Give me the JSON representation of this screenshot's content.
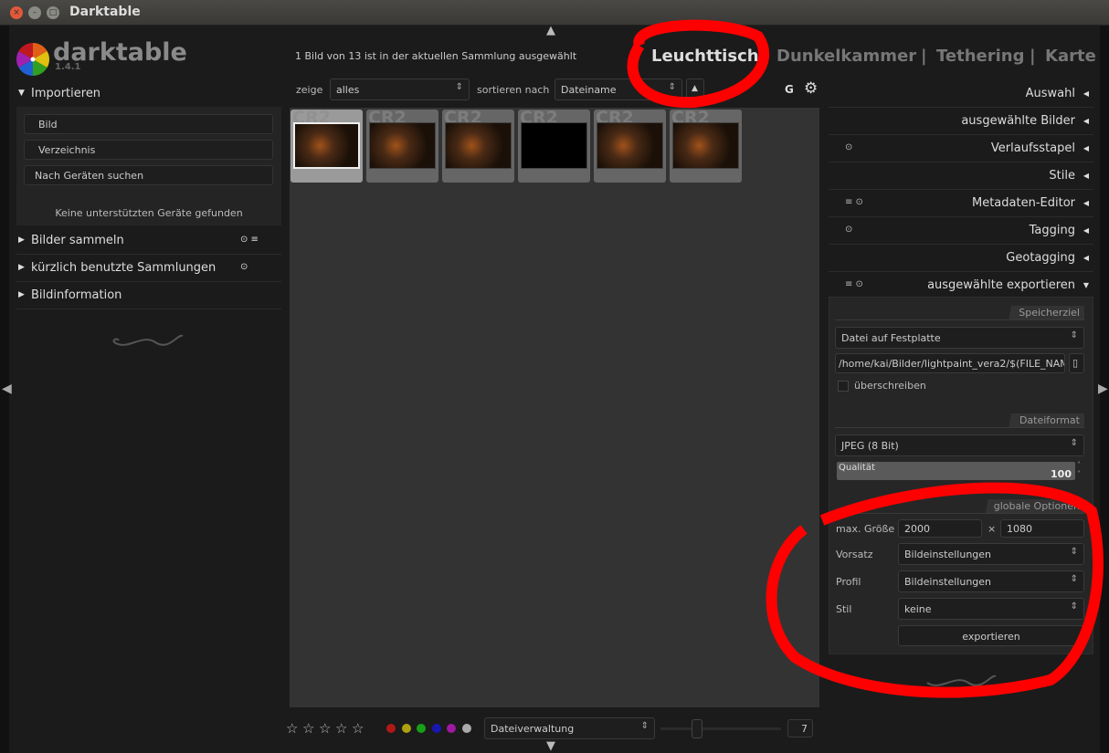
{
  "window": {
    "title": "Darktable"
  },
  "logo": {
    "name": "darktable",
    "version": "1.4.1"
  },
  "status": "1 Bild von 13 ist in der aktuellen Sammlung ausgewählt",
  "views": [
    {
      "label": "Leuchttisch",
      "selected": true
    },
    {
      "sep": "|"
    },
    {
      "label": "Dunkelkammer"
    },
    {
      "label": "Tethering"
    },
    {
      "label": "Karte"
    }
  ],
  "separator": "|",
  "toolbar": {
    "show_label": "zeige",
    "show_value": "alles",
    "sort_label": "sortieren nach",
    "sort_value": "Dateiname",
    "sort_dir": "▲",
    "grouping": "G"
  },
  "left": {
    "import": {
      "title": "Importieren",
      "buttons": [
        "Bild",
        "Verzeichnis",
        "Nach Geräten suchen"
      ],
      "status": "Keine unterstützten Geräte gefunden"
    },
    "modules": [
      "Bilder sammeln",
      "kürzlich benutzte Sammlungen",
      "Bildinformation"
    ]
  },
  "thumbnails": [
    {
      "ext": "CR2",
      "selected": true
    },
    {
      "ext": "CR2"
    },
    {
      "ext": "CR2"
    },
    {
      "ext": "CR2",
      "black": true
    },
    {
      "ext": "CR2"
    },
    {
      "ext": "CR2"
    }
  ],
  "right": {
    "modules": [
      "Auswahl",
      "ausgewählte Bilder",
      "Verlaufsstapel",
      "Stile",
      "Metadaten-Editor",
      "Tagging",
      "Geotagging",
      "ausgewählte exportieren"
    ],
    "export": {
      "target_section": "Speicherziel",
      "target": "Datei auf Festplatte",
      "path": "/home/kai/Bilder/lightpaint_vera2/$(FILE_NAM",
      "overwrite": "überschreiben",
      "overwrite_checked": false,
      "format_section": "Dateiformat",
      "format": "JPEG (8 Bit)",
      "quality_label": "Qualität",
      "quality": "100",
      "global_section": "globale Optionen",
      "max_size_label": "max. Größe",
      "width": "2000",
      "x": "×",
      "height": "1080",
      "preset_label": "Vorsatz",
      "preset": "Bildeinstellungen",
      "profile_label": "Profil",
      "profile": "Bildeinstellungen",
      "style_label": "Stil",
      "style": "keine",
      "export_button": "exportieren"
    }
  },
  "bottom": {
    "stars": [
      "☆",
      "☆",
      "☆",
      "☆",
      "☆"
    ],
    "color_labels": [
      "#b01818",
      "#b0a010",
      "#18a018",
      "#1818b0",
      "#a018a0",
      "#aaaaaa"
    ],
    "layout": "Dateiverwaltung",
    "zoom": "7",
    "zoom_fraction": 0.3
  },
  "annotation_color": "#ff0000"
}
